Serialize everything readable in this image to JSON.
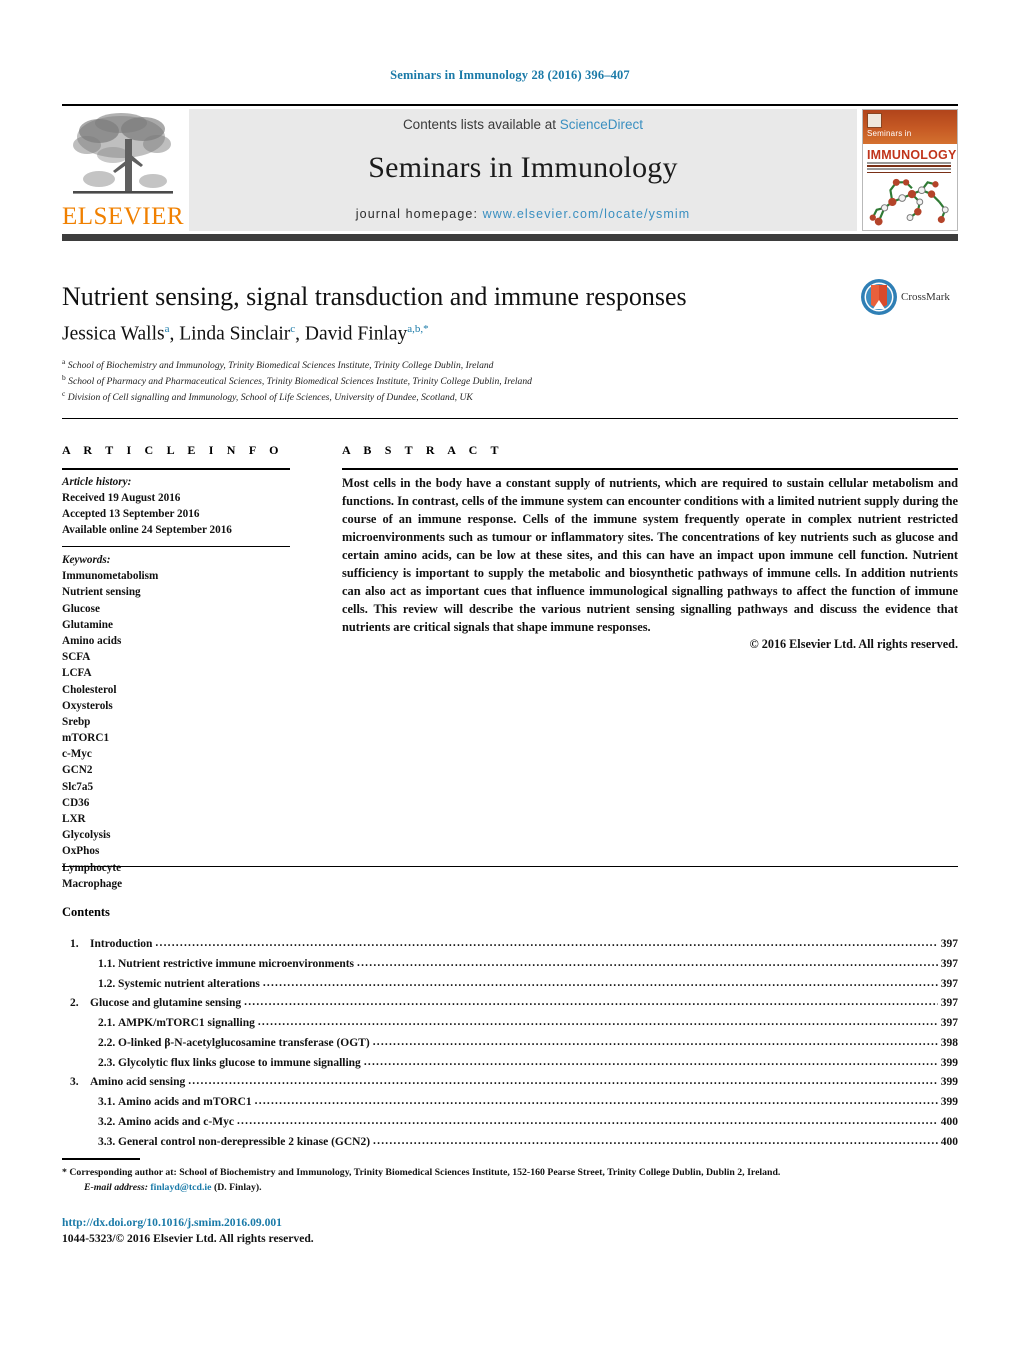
{
  "running_head": "Seminars in Immunology 28 (2016) 396–407",
  "masthead": {
    "publisher_logo_text": "ELSEVIER",
    "contents_line_prefix": "Contents lists available at ",
    "contents_line_link": "ScienceDirect",
    "journal_name": "Seminars in Immunology",
    "homepage_prefix": "journal homepage: ",
    "homepage_url": "www.elsevier.com/locate/ysmim",
    "cover": {
      "top_label": "Seminars in",
      "main_label": "IMMUNOLOGY"
    }
  },
  "article": {
    "title": "Nutrient sensing, signal transduction and immune responses",
    "authors": [
      {
        "name": "Jessica Walls",
        "marks": "a"
      },
      {
        "name": "Linda Sinclair",
        "marks": "c"
      },
      {
        "name": "David Finlay",
        "marks": "a,b,*"
      }
    ],
    "authors_line": "Jessica Walls, Linda Sinclair, David Finlay",
    "affiliations": [
      {
        "mark": "a",
        "text": "School of Biochemistry and Immunology, Trinity Biomedical Sciences Institute, Trinity College Dublin, Ireland"
      },
      {
        "mark": "b",
        "text": "School of Pharmacy and Pharmaceutical Sciences, Trinity Biomedical Sciences Institute, Trinity College Dublin, Ireland"
      },
      {
        "mark": "c",
        "text": "Division of Cell signalling and Immunology, School of Life Sciences, University of Dundee, Scotland, UK"
      }
    ],
    "crossmark_label": "CrossMark"
  },
  "info": {
    "heading": "A R T I C L E   I N F O",
    "history_label": "Article history:",
    "history": [
      "Received 19 August 2016",
      "Accepted 13 September 2016",
      "Available online 24 September 2016"
    ],
    "keywords_label": "Keywords:",
    "keywords": [
      "Immunometabolism",
      "Nutrient sensing",
      "Glucose",
      "Glutamine",
      "Amino acids",
      "SCFA",
      "LCFA",
      "Cholesterol",
      "Oxysterols",
      "Srebp",
      "mTORC1",
      "c-Myc",
      "GCN2",
      "Slc7a5",
      "CD36",
      "LXR",
      "Glycolysis",
      "OxPhos",
      "Lymphocyte",
      "Macrophage"
    ]
  },
  "abstract": {
    "heading": "A B S T R A C T",
    "text": "Most cells in the body have a constant supply of nutrients, which are required to sustain cellular metabolism and functions. In contrast, cells of the immune system can encounter conditions with a limited nutrient supply during the course of an immune response. Cells of the immune system frequently operate in complex nutrient restricted microenvironments such as tumour or inflammatory sites. The concentrations of key nutrients such as glucose and certain amino acids, can be low at these sites, and this can have an impact upon immune cell function. Nutrient sufficiency is important to supply the metabolic and biosynthetic pathways of immune cells. In addition nutrients can also act as important cues that influence immunological signalling pathways to affect the function of immune cells. This review will describe the various nutrient sensing signalling pathways and discuss the evidence that nutrients are critical signals that shape immune responses.",
    "copyright": "© 2016 Elsevier Ltd. All rights reserved."
  },
  "contents": {
    "title": "Contents",
    "entries": [
      {
        "level": 1,
        "num": "1.",
        "label": "Introduction",
        "page": "397"
      },
      {
        "level": 2,
        "num": "1.1.",
        "label": "Nutrient restrictive immune microenvironments",
        "page": "397"
      },
      {
        "level": 2,
        "num": "1.2.",
        "label": "Systemic nutrient alterations",
        "page": "397"
      },
      {
        "level": 1,
        "num": "2.",
        "label": "Glucose and glutamine sensing",
        "page": "397"
      },
      {
        "level": 2,
        "num": "2.1.",
        "label": "AMPK/mTORC1 signalling",
        "page": "397"
      },
      {
        "level": 2,
        "num": "2.2.",
        "label": "O-linked β-N-acetylglucosamine transferase (OGT)",
        "page": "398"
      },
      {
        "level": 2,
        "num": "2.3.",
        "label": "Glycolytic flux links glucose to immune signalling",
        "page": "399"
      },
      {
        "level": 1,
        "num": "3.",
        "label": "Amino acid sensing",
        "page": "399"
      },
      {
        "level": 2,
        "num": "3.1.",
        "label": "Amino acids and mTORC1",
        "page": "399"
      },
      {
        "level": 2,
        "num": "3.2.",
        "label": "Amino acids and c-Myc",
        "page": "400"
      },
      {
        "level": 2,
        "num": "3.3.",
        "label": "General control non-derepressible 2 kinase (GCN2)",
        "page": "400"
      }
    ]
  },
  "footer": {
    "corresponding_mark": "*",
    "corresponding_text": "Corresponding author at: School of Biochemistry and Immunology, Trinity Biomedical Sciences Institute, 152-160 Pearse Street, Trinity College Dublin, Dublin 2, Ireland.",
    "email_label": "E-mail address:",
    "email": "finlayd@tcd.ie",
    "email_suffix": " (D. Finlay).",
    "doi": "http://dx.doi.org/10.1016/j.smim.2016.09.001",
    "issn_line": "1044-5323/© 2016 Elsevier Ltd. All rights reserved."
  },
  "colors": {
    "link_blue": "#1a7aa8",
    "sciencedirect_blue": "#3a8fc0",
    "elsevier_orange": "#F08000",
    "cover_orange": "#c65a24",
    "cover_red": "#c0341b"
  }
}
